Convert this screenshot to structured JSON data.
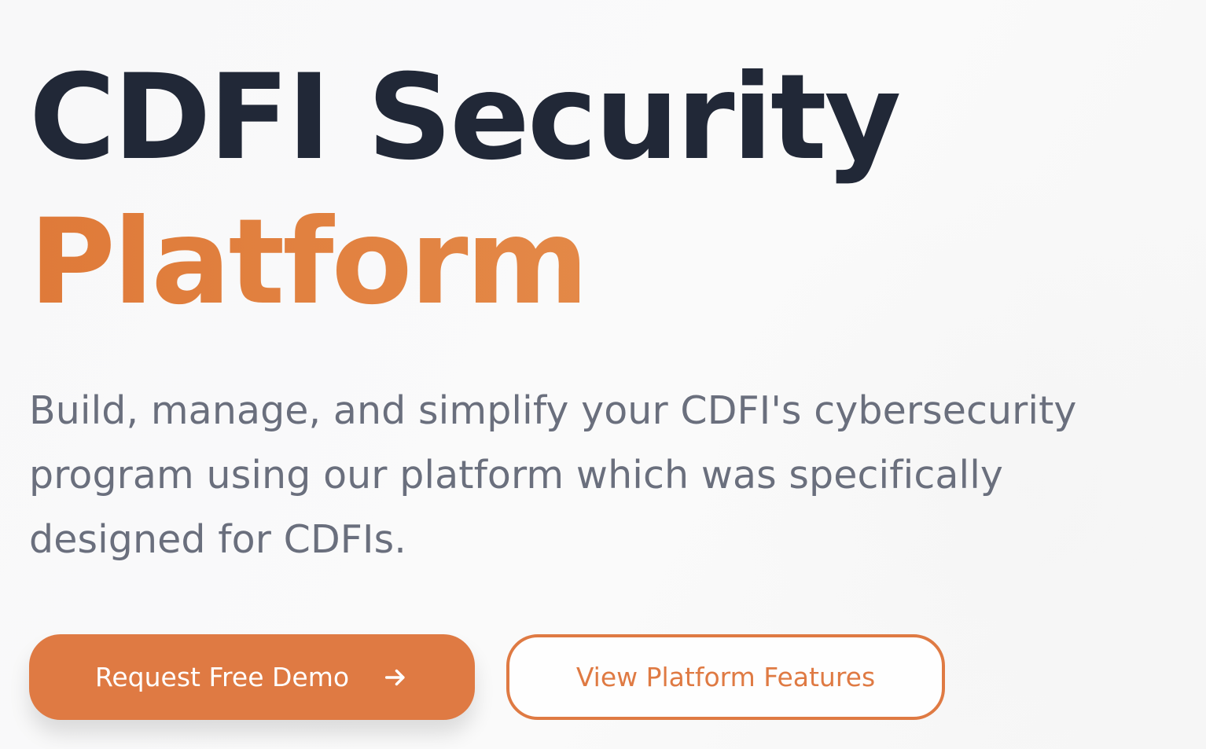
{
  "hero": {
    "title_line_1": "CDFI Security",
    "title_line_2": "Platform",
    "subtitle": "Build, manage, and simplify your CDFI's cybersecurity program using our platform which was specifically designed for CDFIs."
  },
  "buttons": {
    "primary_label": "Request Free Demo",
    "primary_icon": "arrow-right-icon",
    "secondary_label": "View Platform Features"
  },
  "colors": {
    "accent": "#df7a43",
    "heading": "#212837",
    "body_text": "#6a6f7d",
    "background": "#f8f8f9"
  }
}
